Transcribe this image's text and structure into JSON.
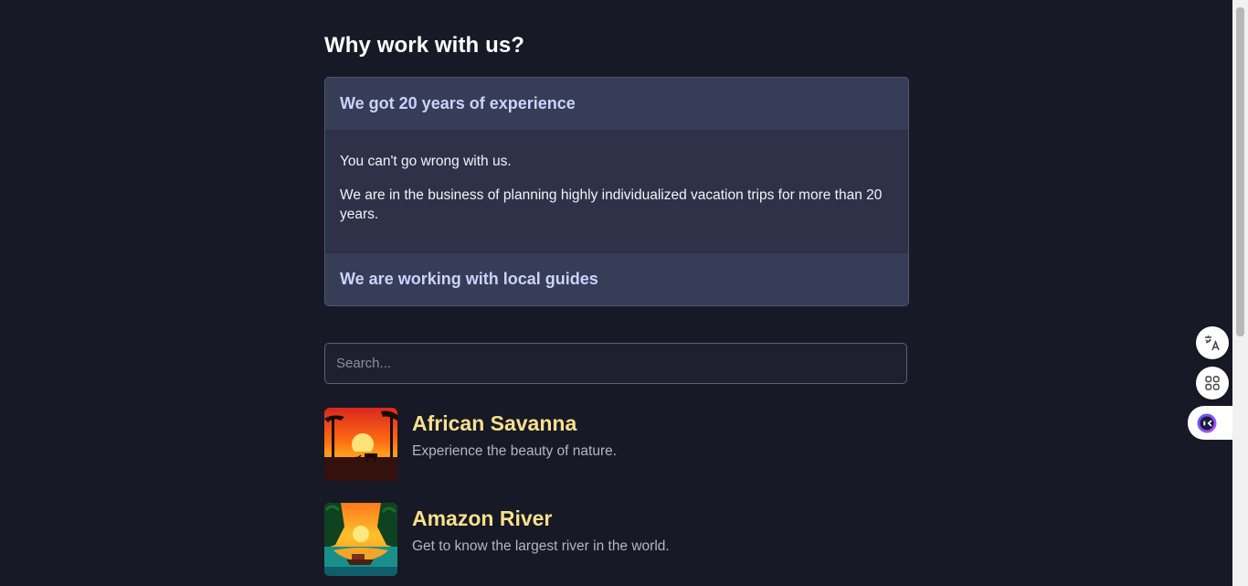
{
  "section": {
    "title": "Why work with us?"
  },
  "accordion": {
    "items": [
      {
        "title": "We got 20 years of experience",
        "paragraphs": [
          "You can't go wrong with us.",
          "We are in the business of planning highly individualized vacation trips for more than 20 years."
        ],
        "expanded": true
      },
      {
        "title": "We are working with local guides",
        "expanded": false
      }
    ]
  },
  "search": {
    "placeholder": "Search...",
    "value": ""
  },
  "results": [
    {
      "title": "African Savanna",
      "description": "Experience the beauty of nature.",
      "image": "savanna-sunset-image"
    },
    {
      "title": "Amazon River",
      "description": "Get to know the largest river in the world.",
      "image": "amazon-river-image"
    }
  ],
  "side_tools": {
    "icons": [
      "translate-icon",
      "apps-grid-icon",
      "assistant-icon"
    ]
  },
  "colors": {
    "background": "#171926",
    "accordion_header": "#373c57",
    "accordion_body": "#2d3248",
    "result_title": "#f7e08d"
  }
}
